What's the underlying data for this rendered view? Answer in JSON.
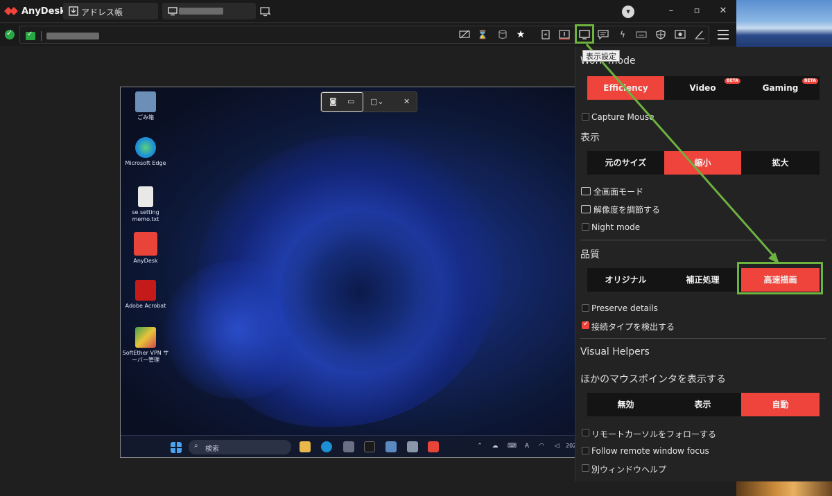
{
  "app": {
    "name": "AnyDesk"
  },
  "tabs": [
    {
      "label": "アドレス帳",
      "icon": "address-book-icon"
    },
    {
      "label": "",
      "icon": "monitor-icon"
    }
  ],
  "tooltip": {
    "text": "表示設定"
  },
  "panel": {
    "work_mode": {
      "title": "Work mode",
      "options": [
        "Efficiency",
        "Video",
        "Gaming"
      ],
      "beta": "BETA",
      "selected": "Efficiency"
    },
    "capture_mouse": {
      "label": "Capture Mouse",
      "checked": false
    },
    "display": {
      "title": "表示",
      "options": [
        "元のサイズ",
        "縮小",
        "拡大"
      ],
      "selected": "縮小"
    },
    "fullscreen": {
      "label": "全画面モード"
    },
    "adjust_resolution": {
      "label": "解像度を調節する"
    },
    "night_mode": {
      "label": "Night mode",
      "checked": false
    },
    "quality": {
      "title": "品質",
      "options": [
        "オリジナル",
        "補正処理",
        "高速描画"
      ],
      "selected": "高速描画"
    },
    "preserve_details": {
      "label": "Preserve details",
      "checked": false
    },
    "detect_connection": {
      "label": "接続タイプを検出する",
      "checked": true
    },
    "visual_helpers": {
      "title": "Visual Helpers"
    },
    "show_other_pointer": {
      "title": "ほかのマウスポインタを表示する",
      "options": [
        "無効",
        "表示",
        "自動"
      ],
      "selected": "自動"
    },
    "follow_cursor": {
      "label": "リモートカーソルをフォローする",
      "checked": false
    },
    "follow_window": {
      "label": "Follow remote window focus",
      "checked": false
    },
    "separate_window_help": {
      "label": "別ウィンドウヘルプ",
      "checked": false
    }
  },
  "remote": {
    "desktop_icons": [
      {
        "label": "ごみ箱",
        "color": "#6c8fb8"
      },
      {
        "label": "Microsoft Edge",
        "color": "#1d8fd6"
      },
      {
        "label": "se setting memo.txt",
        "color": "#e8e8e8"
      },
      {
        "label": "AnyDesk",
        "color": "#e8443a"
      },
      {
        "label": "Adobe Acrobat",
        "color": "#c51a1a"
      },
      {
        "label": "SoftEther VPN サーバー管理",
        "color": "#3fa34d"
      }
    ],
    "taskbar": {
      "search_placeholder": "検索",
      "time": "202"
    }
  },
  "colors": {
    "accent": "#ef443b",
    "highlight": "#6db33f"
  }
}
